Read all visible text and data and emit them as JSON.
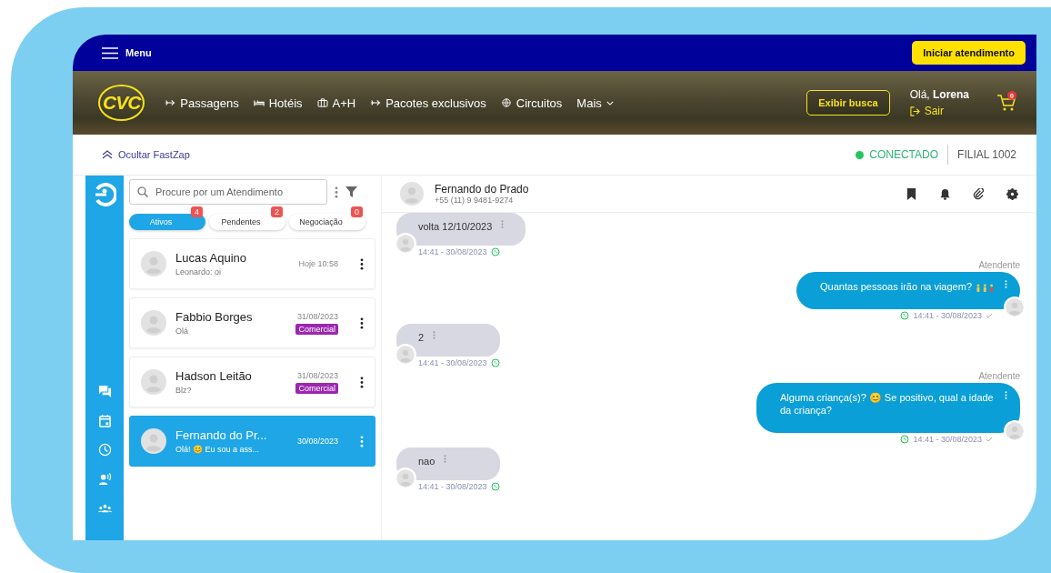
{
  "topbar": {
    "menu_label": "Menu",
    "action_button": "Iniciar atendimento"
  },
  "nav": {
    "logo": "CVC",
    "items": [
      {
        "label": "Passagens"
      },
      {
        "label": "Hotéis"
      },
      {
        "label": "A+H"
      },
      {
        "label": "Pacotes exclusivos"
      },
      {
        "label": "Circuitos"
      },
      {
        "label": "Mais"
      }
    ],
    "search_button": "Exibir busca",
    "greeting": "Olá, **Lorena**",
    "logout": "Sair",
    "cart_count": "0"
  },
  "fastzap": {
    "toggle": "Ocultar FastZap",
    "online": true,
    "status": "CONECTADO",
    "branch": "FILIAL 1002"
  },
  "contacts": {
    "search_placeholder": "Procure por um Atendimento",
    "tabs": [
      {
        "label": "Ativos",
        "count": "4",
        "selected": true
      },
      {
        "label": "Pendentes",
        "count": "2",
        "selected": false
      },
      {
        "label": "Negociação",
        "count": "0",
        "selected": false
      }
    ],
    "items": [
      {
        "name": "Lucas Aquino",
        "preview": "Leonardo: oi",
        "time": "Hoje 10:58",
        "selected": false
      },
      {
        "name": "Fabbio Borges",
        "preview": "Olá",
        "time": "31/08/2023",
        "tag": "Comercial",
        "selected": false
      },
      {
        "name": "Hadson Leitão",
        "preview": "Blz?",
        "time": "31/08/2023",
        "tag": "Comercial",
        "selected": false
      },
      {
        "name": "Fernando do Pr...",
        "preview": "Olá! 😊 Eu sou a ass...",
        "time": "30/08/2023",
        "selected": true
      }
    ]
  },
  "chat": {
    "name": "Fernando do Prado",
    "phone": "+55 (11) 9 9481-9274",
    "messages": [
      {
        "kind": "incoming",
        "text": "volta 12/10/2023",
        "time": "14:41 - 30/08/2023"
      },
      {
        "kind": "outgoing",
        "sender": "Atendente",
        "text": "Quantas pessoas irão na viagem?",
        "time": "14:41 - 30/08/2023"
      },
      {
        "kind": "incoming",
        "text": "2",
        "time": "14:41 - 30/08/2023"
      },
      {
        "kind": "outgoing",
        "sender": "Atendente",
        "text": "Alguma criança(s)? 😊 Se positivo, qual a idade da criança?",
        "time": "14:41 - 30/08/2023"
      },
      {
        "kind": "incoming",
        "text": "nao",
        "time": "14:41 - 30/08/2023"
      }
    ]
  }
}
